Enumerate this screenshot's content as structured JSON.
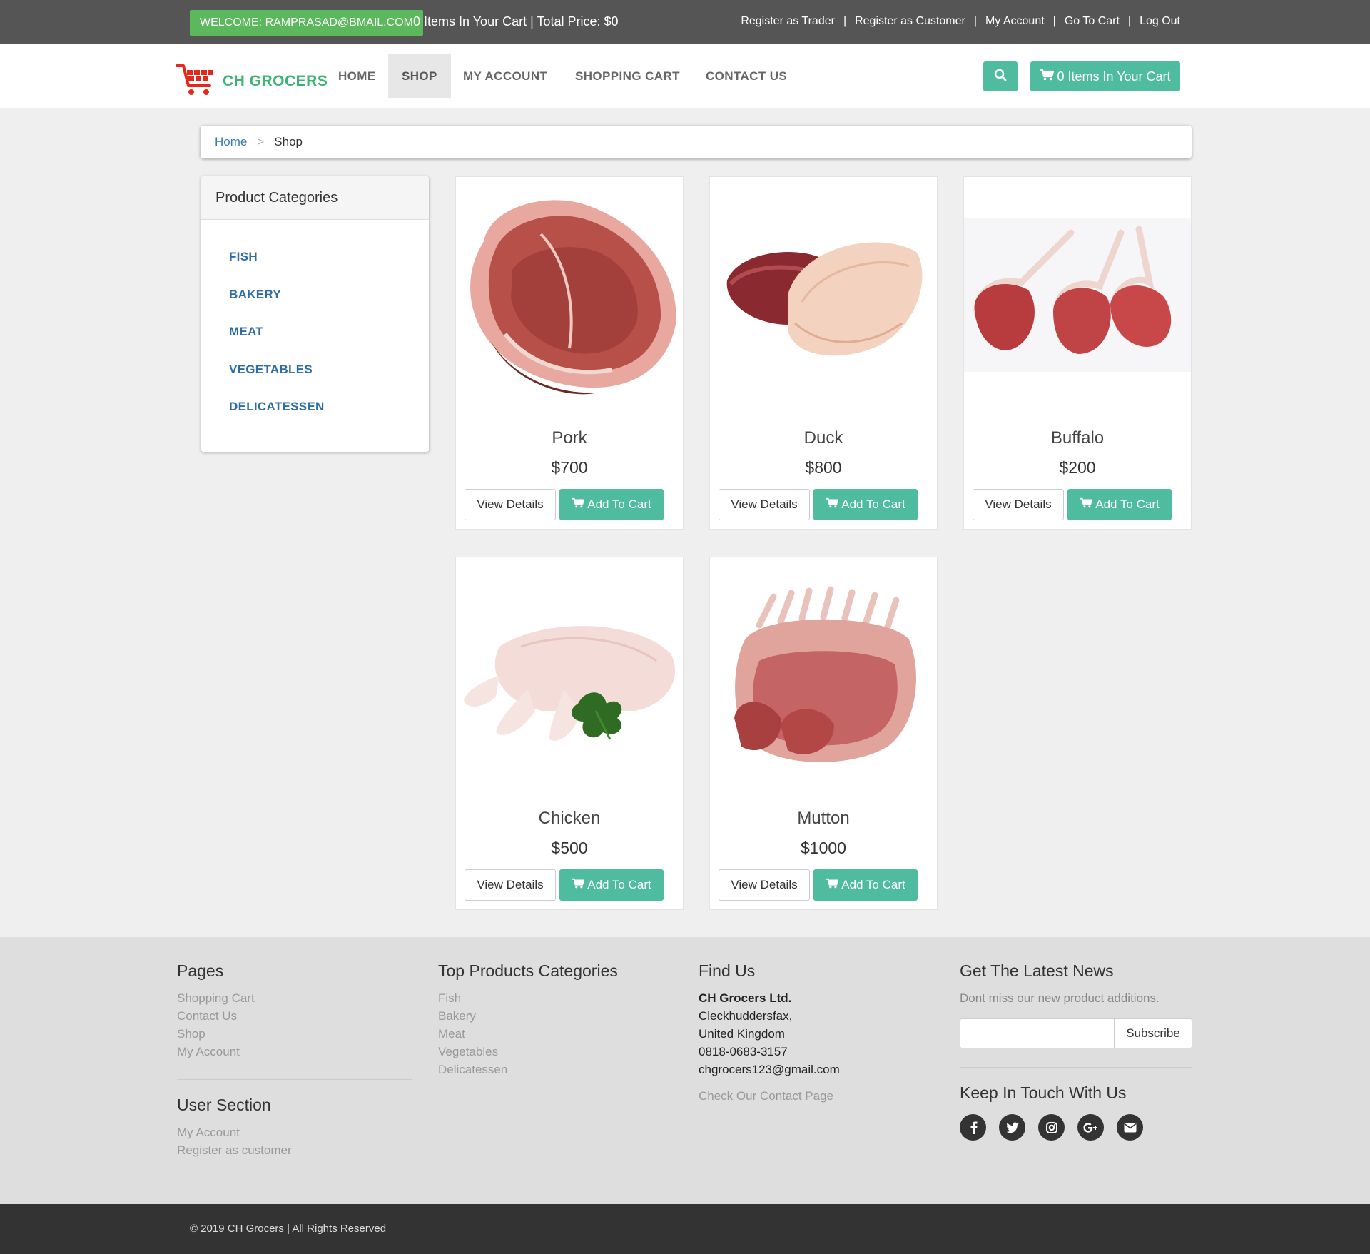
{
  "topbar": {
    "welcome": "WELCOME: RAMPRASAD@BMAIL.COM",
    "cart_summary": "0 Items In Your Cart | Total Price: $0",
    "links": [
      "Register as Trader",
      "Register as Customer",
      "My Account",
      "Go To Cart",
      "Log Out"
    ],
    "separator": "|"
  },
  "brand": {
    "name": "CH GROCERS",
    "color": "#3cb371"
  },
  "nav": {
    "items": [
      "HOME",
      "SHOP",
      "MY ACCOUNT",
      "SHOPPING CART",
      "CONTACT US"
    ],
    "active": "SHOP",
    "cart_button": "0 Items In Your Cart",
    "search_icon": "search-icon",
    "cart_icon": "cart-icon"
  },
  "breadcrumb": {
    "home": "Home",
    "separator": ">",
    "current": "Shop"
  },
  "categories": {
    "title": "Product Categories",
    "items": [
      "FISH",
      "BAKERY",
      "MEAT",
      "VEGETABLES",
      "DELICATESSEN"
    ]
  },
  "products": [
    {
      "name": "Pork",
      "price": "$700",
      "view": "View Details",
      "add": "Add To Cart"
    },
    {
      "name": "Duck",
      "price": "$800",
      "view": "View Details",
      "add": "Add To Cart"
    },
    {
      "name": "Buffalo",
      "price": "$200",
      "view": "View Details",
      "add": "Add To Cart"
    },
    {
      "name": "Chicken",
      "price": "$500",
      "view": "View Details",
      "add": "Add To Cart"
    },
    {
      "name": "Mutton",
      "price": "$1000",
      "view": "View Details",
      "add": "Add To Cart"
    }
  ],
  "footer": {
    "pages": {
      "title": "Pages",
      "links": [
        "Shopping Cart",
        "Contact Us",
        "Shop",
        "My Account"
      ]
    },
    "user_section": {
      "title": "User Section",
      "links": [
        "My Account",
        "Register as customer"
      ]
    },
    "top_categories": {
      "title": "Top Products Categories",
      "links": [
        "Fish",
        "Bakery",
        "Meat",
        "Vegetables",
        "Delicatessen"
      ]
    },
    "find_us": {
      "title": "Find Us",
      "company": "CH Grocers Ltd.",
      "lines": [
        "Cleckhuddersfax,",
        "United Kingdom",
        "0818-0683-3157",
        "chgrocers123@gmail.com"
      ],
      "contact_link": "Check Our Contact Page"
    },
    "news": {
      "title": "Get The Latest News",
      "text": "Dont miss our new product additions.",
      "subscribe": "Subscribe"
    },
    "keep_in_touch": {
      "title": "Keep In Touch With Us",
      "icons": [
        "facebook-icon",
        "twitter-icon",
        "instagram-icon",
        "google-plus-icon",
        "email-icon"
      ]
    },
    "copyright": "© 2019 CH Grocers | All Rights Reserved"
  },
  "colors": {
    "accent": "#4fbb9f",
    "welcome": "#5cb85c",
    "link": "#2e6da4"
  }
}
